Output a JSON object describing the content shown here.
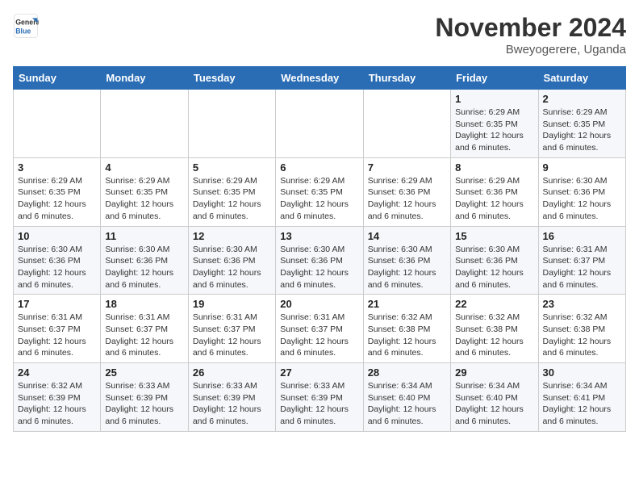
{
  "logo": {
    "line1": "General",
    "line2": "Blue"
  },
  "title": "November 2024",
  "location": "Bweyogerere, Uganda",
  "days_header": [
    "Sunday",
    "Monday",
    "Tuesday",
    "Wednesday",
    "Thursday",
    "Friday",
    "Saturday"
  ],
  "weeks": [
    [
      {
        "day": "",
        "detail": ""
      },
      {
        "day": "",
        "detail": ""
      },
      {
        "day": "",
        "detail": ""
      },
      {
        "day": "",
        "detail": ""
      },
      {
        "day": "",
        "detail": ""
      },
      {
        "day": "1",
        "detail": "Sunrise: 6:29 AM\nSunset: 6:35 PM\nDaylight: 12 hours\nand 6 minutes."
      },
      {
        "day": "2",
        "detail": "Sunrise: 6:29 AM\nSunset: 6:35 PM\nDaylight: 12 hours\nand 6 minutes."
      }
    ],
    [
      {
        "day": "3",
        "detail": "Sunrise: 6:29 AM\nSunset: 6:35 PM\nDaylight: 12 hours\nand 6 minutes."
      },
      {
        "day": "4",
        "detail": "Sunrise: 6:29 AM\nSunset: 6:35 PM\nDaylight: 12 hours\nand 6 minutes."
      },
      {
        "day": "5",
        "detail": "Sunrise: 6:29 AM\nSunset: 6:35 PM\nDaylight: 12 hours\nand 6 minutes."
      },
      {
        "day": "6",
        "detail": "Sunrise: 6:29 AM\nSunset: 6:35 PM\nDaylight: 12 hours\nand 6 minutes."
      },
      {
        "day": "7",
        "detail": "Sunrise: 6:29 AM\nSunset: 6:36 PM\nDaylight: 12 hours\nand 6 minutes."
      },
      {
        "day": "8",
        "detail": "Sunrise: 6:29 AM\nSunset: 6:36 PM\nDaylight: 12 hours\nand 6 minutes."
      },
      {
        "day": "9",
        "detail": "Sunrise: 6:30 AM\nSunset: 6:36 PM\nDaylight: 12 hours\nand 6 minutes."
      }
    ],
    [
      {
        "day": "10",
        "detail": "Sunrise: 6:30 AM\nSunset: 6:36 PM\nDaylight: 12 hours\nand 6 minutes."
      },
      {
        "day": "11",
        "detail": "Sunrise: 6:30 AM\nSunset: 6:36 PM\nDaylight: 12 hours\nand 6 minutes."
      },
      {
        "day": "12",
        "detail": "Sunrise: 6:30 AM\nSunset: 6:36 PM\nDaylight: 12 hours\nand 6 minutes."
      },
      {
        "day": "13",
        "detail": "Sunrise: 6:30 AM\nSunset: 6:36 PM\nDaylight: 12 hours\nand 6 minutes."
      },
      {
        "day": "14",
        "detail": "Sunrise: 6:30 AM\nSunset: 6:36 PM\nDaylight: 12 hours\nand 6 minutes."
      },
      {
        "day": "15",
        "detail": "Sunrise: 6:30 AM\nSunset: 6:36 PM\nDaylight: 12 hours\nand 6 minutes."
      },
      {
        "day": "16",
        "detail": "Sunrise: 6:31 AM\nSunset: 6:37 PM\nDaylight: 12 hours\nand 6 minutes."
      }
    ],
    [
      {
        "day": "17",
        "detail": "Sunrise: 6:31 AM\nSunset: 6:37 PM\nDaylight: 12 hours\nand 6 minutes."
      },
      {
        "day": "18",
        "detail": "Sunrise: 6:31 AM\nSunset: 6:37 PM\nDaylight: 12 hours\nand 6 minutes."
      },
      {
        "day": "19",
        "detail": "Sunrise: 6:31 AM\nSunset: 6:37 PM\nDaylight: 12 hours\nand 6 minutes."
      },
      {
        "day": "20",
        "detail": "Sunrise: 6:31 AM\nSunset: 6:37 PM\nDaylight: 12 hours\nand 6 minutes."
      },
      {
        "day": "21",
        "detail": "Sunrise: 6:32 AM\nSunset: 6:38 PM\nDaylight: 12 hours\nand 6 minutes."
      },
      {
        "day": "22",
        "detail": "Sunrise: 6:32 AM\nSunset: 6:38 PM\nDaylight: 12 hours\nand 6 minutes."
      },
      {
        "day": "23",
        "detail": "Sunrise: 6:32 AM\nSunset: 6:38 PM\nDaylight: 12 hours\nand 6 minutes."
      }
    ],
    [
      {
        "day": "24",
        "detail": "Sunrise: 6:32 AM\nSunset: 6:39 PM\nDaylight: 12 hours\nand 6 minutes."
      },
      {
        "day": "25",
        "detail": "Sunrise: 6:33 AM\nSunset: 6:39 PM\nDaylight: 12 hours\nand 6 minutes."
      },
      {
        "day": "26",
        "detail": "Sunrise: 6:33 AM\nSunset: 6:39 PM\nDaylight: 12 hours\nand 6 minutes."
      },
      {
        "day": "27",
        "detail": "Sunrise: 6:33 AM\nSunset: 6:39 PM\nDaylight: 12 hours\nand 6 minutes."
      },
      {
        "day": "28",
        "detail": "Sunrise: 6:34 AM\nSunset: 6:40 PM\nDaylight: 12 hours\nand 6 minutes."
      },
      {
        "day": "29",
        "detail": "Sunrise: 6:34 AM\nSunset: 6:40 PM\nDaylight: 12 hours\nand 6 minutes."
      },
      {
        "day": "30",
        "detail": "Sunrise: 6:34 AM\nSunset: 6:41 PM\nDaylight: 12 hours\nand 6 minutes."
      }
    ]
  ]
}
